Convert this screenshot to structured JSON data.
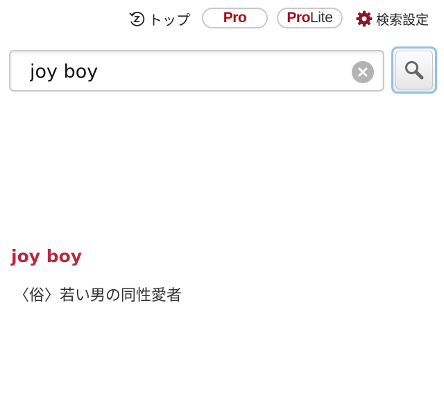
{
  "topbar": {
    "top_label": "トップ",
    "top_icon": "back-arrow-icon",
    "pro": {
      "label": "Pro",
      "color": "#a3101b"
    },
    "prolite": {
      "pro_part": "Pro",
      "lite_part": "Lite"
    },
    "settings_label": "検索設定",
    "settings_icon": "gear-icon",
    "settings_icon_color": "#8a1620"
  },
  "search": {
    "value": "joy boy",
    "clear_icon": "clear-icon",
    "button_icon": "search-icon",
    "button_border_color": "#8fc0ef"
  },
  "result": {
    "headword": "joy boy",
    "headword_color": "#b52a3f",
    "definition": "〈俗〉若い男の同性愛者"
  }
}
